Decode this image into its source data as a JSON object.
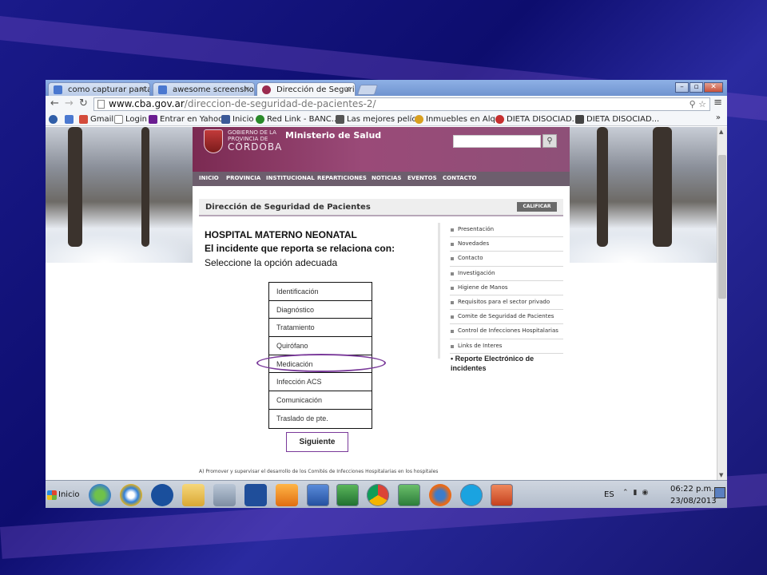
{
  "browser": {
    "tabs": [
      {
        "label": "como capturar pantalla",
        "icon": "google-icon"
      },
      {
        "label": "awesome screenshot c",
        "icon": "google-icon"
      },
      {
        "label": "Dirección de Segurida",
        "icon": "cordoba-icon"
      }
    ],
    "url_host": "www.cba.gov.ar",
    "url_path": "/direccion-de-seguridad-de-pacientes-2/",
    "bookmarks": [
      "Gmail",
      "Login",
      "Entrar en Yahoo!",
      "Inicio",
      "Red Link - BANC...",
      "Las mejores pelíc...",
      "Inmuebles en Alq...",
      "DIETA DISOCIAD...",
      "DIETA DISOCIAD..."
    ],
    "bookmarks_more": "»"
  },
  "site": {
    "logo_line1": "GOBIERNO DE LA",
    "logo_line2": "PROVINCIA DE",
    "logo_line3": "CÓRDOBA",
    "ministry": "Ministerio de Salud",
    "nav": [
      "INICIO",
      "PROVINCIA",
      "INSTITUCIONAL",
      "REPARTICIONES",
      "NOTICIAS",
      "EVENTOS",
      "CONTACTO"
    ],
    "page_title": "Dirección de Seguridad de Pacientes",
    "calificar": "CALIFICAR",
    "sidebar": [
      "Presentación",
      "Novedades",
      "Contacto",
      "Investigación",
      "Higiene de Manos",
      "Requisitos para el sector privado",
      "Comite de Seguridad de Pacientes",
      "Control de Infecciones Hospitalarias",
      "Links de Interes"
    ],
    "footer_text": "A) Promover y supervisar el desarrollo de los Comités de Infecciones Hospitalarias en los hospitales"
  },
  "slide": {
    "heading1": "HOSPITAL MATERNO NEONATAL",
    "heading2": "El incidente que reporta se relaciona con:",
    "heading3": "Seleccione la opción adecuada",
    "options": [
      "Identificación",
      "Diagnóstico",
      "Tratamiento",
      "Quirófano",
      "Medicación",
      "Infección ACS",
      "Comunicación",
      "Traslado de pte."
    ],
    "highlighted_option": "Medicación",
    "next_button": "Siguiente",
    "reporte": "• Reporte Electrónico de incidentes",
    "highlight_color": "#7a3a9a"
  },
  "taskbar": {
    "start_label": "Inicio",
    "lang": "ES",
    "time": "06:22 p.m.",
    "date": "23/08/2013"
  }
}
